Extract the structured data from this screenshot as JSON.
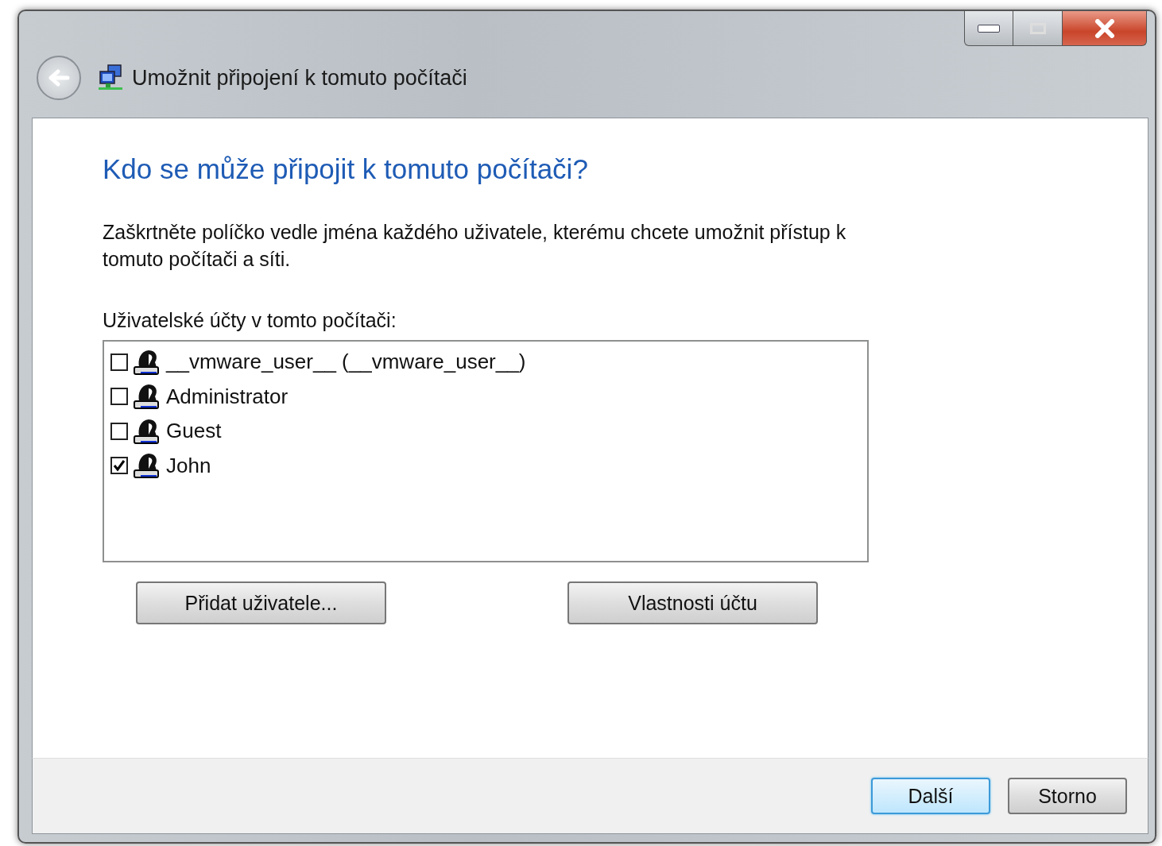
{
  "window": {
    "title": "Umožnit připojení k tomuto počítači"
  },
  "heading": "Kdo se může připojit k tomuto počítači?",
  "instructions": "Zaškrtněte políčko vedle jména každého uživatele, kterému chcete umožnit přístup k tomuto počítači a síti.",
  "accounts_label": "Uživatelské účty v tomto počítači:",
  "accounts": [
    {
      "name": "__vmware_user__ (__vmware_user__)",
      "checked": false
    },
    {
      "name": "Administrator",
      "checked": false
    },
    {
      "name": "Guest",
      "checked": false
    },
    {
      "name": "John",
      "checked": true
    }
  ],
  "list_buttons": [
    "Přidat uživatele...",
    "Vlastnosti účtu"
  ],
  "footer_buttons": [
    {
      "label": "Další",
      "default": true
    },
    {
      "label": "Storno",
      "default": false
    }
  ]
}
